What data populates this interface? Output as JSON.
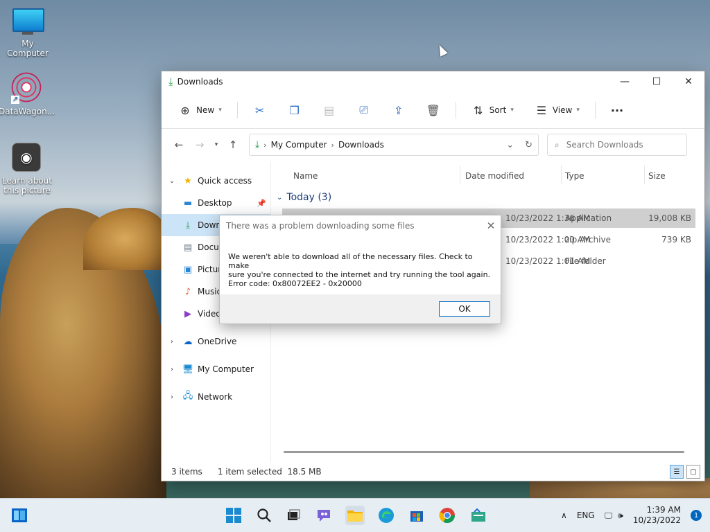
{
  "desktop": {
    "icons": [
      {
        "label": "My Computer"
      },
      {
        "label": "DataWagon..."
      },
      {
        "label": "Learn about this picture"
      }
    ]
  },
  "window": {
    "title": "Downloads",
    "toolbar": {
      "new_label": "New",
      "sort_label": "Sort",
      "view_label": "View",
      "more_label": "···"
    },
    "address": {
      "crumbs": [
        "My Computer",
        "Downloads"
      ]
    },
    "search": {
      "placeholder": "Search Downloads"
    },
    "nav": {
      "quick_access": "Quick access",
      "items": [
        "Desktop",
        "Downloads",
        "Documents",
        "Pictures",
        "Music",
        "Videos"
      ],
      "onedrive": "OneDrive",
      "my_computer": "My Computer",
      "network": "Network"
    },
    "columns": {
      "name": "Name",
      "date": "Date modified",
      "type": "Type",
      "size": "Size"
    },
    "group": {
      "label": "Today (3)"
    },
    "rows": [
      {
        "date": "10/23/2022 1:36 AM",
        "type": "Application",
        "size": "19,008 KB"
      },
      {
        "date": "10/23/2022 1:00 AM",
        "type": "zip Archive",
        "size": "739 KB"
      },
      {
        "date": "10/23/2022 1:01 AM",
        "type": "File folder",
        "size": ""
      }
    ],
    "status": {
      "items": "3 items",
      "selected": "1 item selected",
      "size": "18.5 MB"
    }
  },
  "dialog": {
    "title": "There was a problem downloading some files",
    "line1": "We weren't able to download all of the necessary files. Check to make",
    "line2": "sure you're connected to the internet and try running the tool again.",
    "line3": "Error code: 0x80072EE2 - 0x20000",
    "ok_label": "OK"
  },
  "taskbar": {
    "lang": "ENG",
    "time": "1:39 AM",
    "date": "10/23/2022",
    "notifications": "1"
  },
  "colors": {
    "accent": "#0067c0",
    "selection": "#cce4f7"
  }
}
